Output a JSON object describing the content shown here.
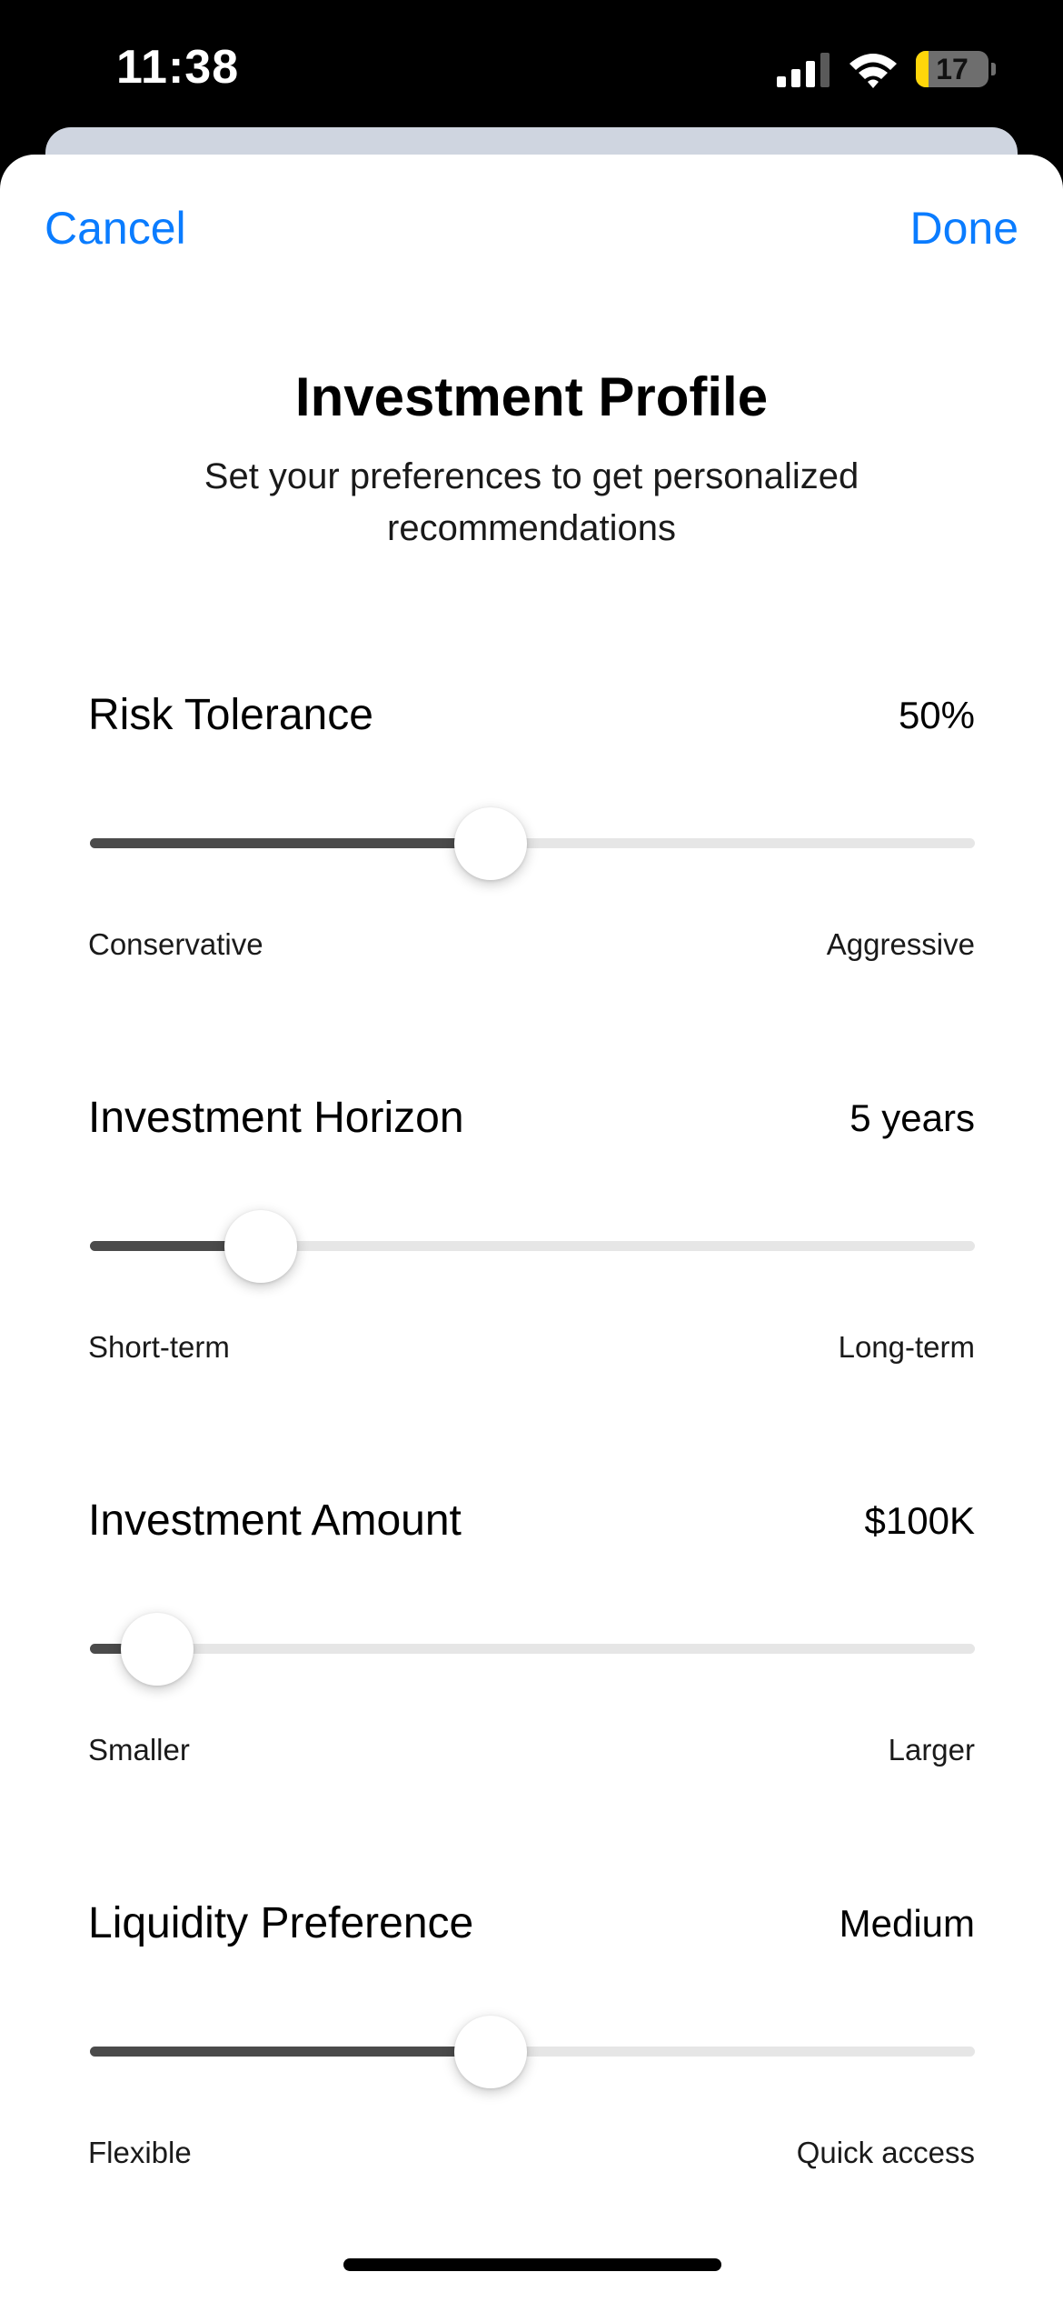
{
  "status_bar": {
    "time": "11:38",
    "battery_level": "17",
    "battery_fraction": 0.17,
    "signal_icon": "cellular-signal-icon",
    "wifi_icon": "wifi-icon",
    "battery_icon": "battery-icon",
    "battery_color": "#ffd60a"
  },
  "nav": {
    "cancel_label": "Cancel",
    "done_label": "Done",
    "accent_color": "#0a7cff"
  },
  "header": {
    "title": "Investment Profile",
    "subtitle": "Set your preferences to get personalized recommendations"
  },
  "sliders": [
    {
      "label": "Risk Tolerance",
      "value_text": "50%",
      "min_label": "Conservative",
      "max_label": "Aggressive",
      "fraction": 0.45
    },
    {
      "label": "Investment Horizon",
      "value_text": "5 years",
      "min_label": "Short-term",
      "max_label": "Long-term",
      "fraction": 0.167
    },
    {
      "label": "Investment Amount",
      "value_text": "$100K",
      "min_label": "Smaller",
      "max_label": "Larger",
      "fraction": 0.04
    },
    {
      "label": "Liquidity Preference",
      "value_text": "Medium",
      "min_label": "Flexible",
      "max_label": "Quick access",
      "fraction": 0.45
    }
  ],
  "colors": {
    "slider_fill": "#4b4b4b",
    "slider_track": "#e6e6e6"
  }
}
